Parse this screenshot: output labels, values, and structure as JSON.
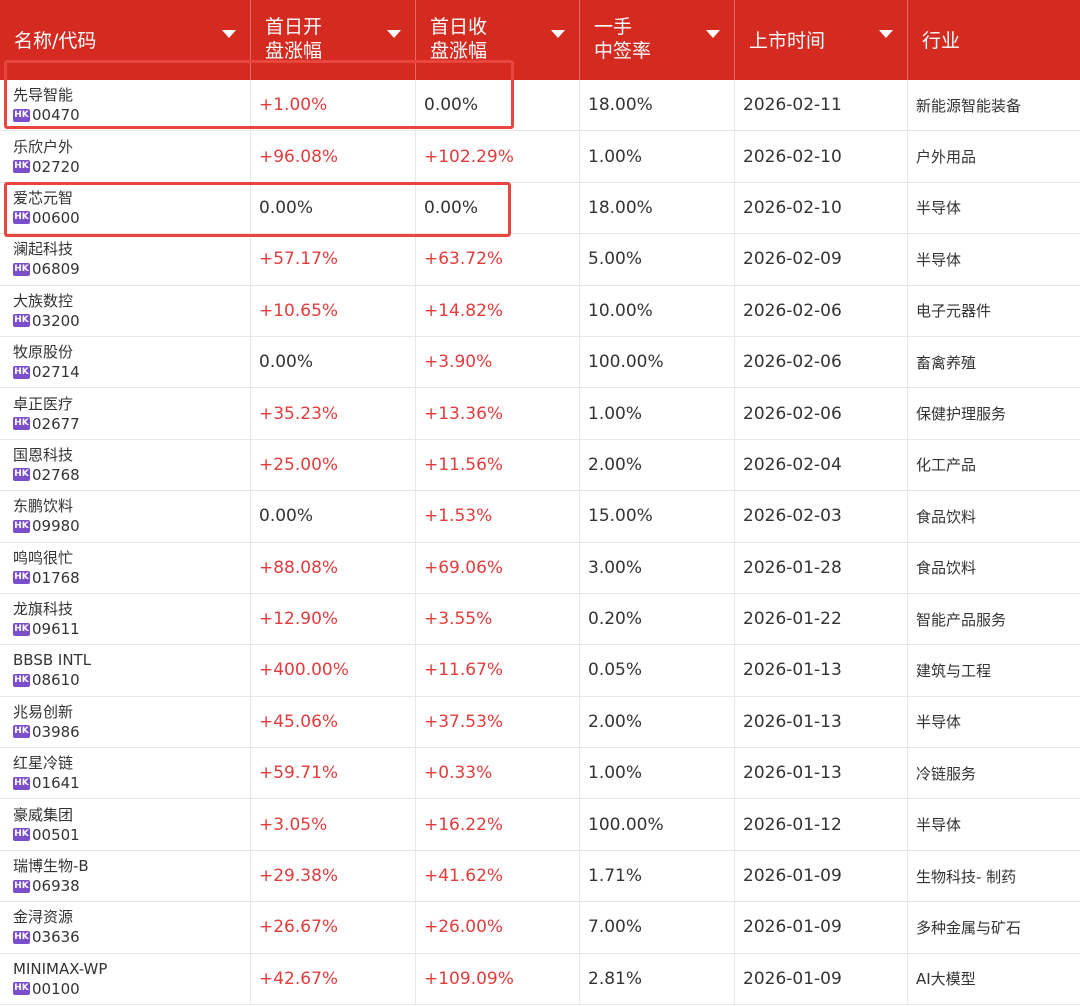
{
  "header": {
    "col_name": "名称/代码",
    "col_open_l1": "首日开",
    "col_open_l2": "盘涨幅",
    "col_close_l1": "首日收",
    "col_close_l2": "盘涨幅",
    "col_rate_l1": "一手",
    "col_rate_l2": "中签率",
    "col_date": "上市时间",
    "col_industry": "行业"
  },
  "badge": "HK",
  "colors": {
    "header_bg": "#d42a20",
    "positive": "#e23c3c",
    "badge": "#7b4fc9",
    "highlight": "#e8473f"
  },
  "rows": [
    {
      "name": "先导智能",
      "code": "00470",
      "open": "+1.00%",
      "close": "0.00%",
      "rate": "18.00%",
      "date": "2026-02-11",
      "industry": "新能源智能装备"
    },
    {
      "name": "乐欣户外",
      "code": "02720",
      "open": "+96.08%",
      "close": "+102.29%",
      "rate": "1.00%",
      "date": "2026-02-10",
      "industry": "户外用品"
    },
    {
      "name": "爱芯元智",
      "code": "00600",
      "open": "0.00%",
      "close": "0.00%",
      "rate": "18.00%",
      "date": "2026-02-10",
      "industry": "半导体"
    },
    {
      "name": "澜起科技",
      "code": "06809",
      "open": "+57.17%",
      "close": "+63.72%",
      "rate": "5.00%",
      "date": "2026-02-09",
      "industry": "半导体"
    },
    {
      "name": "大族数控",
      "code": "03200",
      "open": "+10.65%",
      "close": "+14.82%",
      "rate": "10.00%",
      "date": "2026-02-06",
      "industry": "电子元器件"
    },
    {
      "name": "牧原股份",
      "code": "02714",
      "open": "0.00%",
      "close": "+3.90%",
      "rate": "100.00%",
      "date": "2026-02-06",
      "industry": "畜禽养殖"
    },
    {
      "name": "卓正医疗",
      "code": "02677",
      "open": "+35.23%",
      "close": "+13.36%",
      "rate": "1.00%",
      "date": "2026-02-06",
      "industry": "保健护理服务"
    },
    {
      "name": "国恩科技",
      "code": "02768",
      "open": "+25.00%",
      "close": "+11.56%",
      "rate": "2.00%",
      "date": "2026-02-04",
      "industry": "化工产品"
    },
    {
      "name": "东鹏饮料",
      "code": "09980",
      "open": "0.00%",
      "close": "+1.53%",
      "rate": "15.00%",
      "date": "2026-02-03",
      "industry": "食品饮料"
    },
    {
      "name": "鸣鸣很忙",
      "code": "01768",
      "open": "+88.08%",
      "close": "+69.06%",
      "rate": "3.00%",
      "date": "2026-01-28",
      "industry": "食品饮料"
    },
    {
      "name": "龙旗科技",
      "code": "09611",
      "open": "+12.90%",
      "close": "+3.55%",
      "rate": "0.20%",
      "date": "2026-01-22",
      "industry": "智能产品服务"
    },
    {
      "name": "BBSB INTL",
      "code": "08610",
      "open": "+400.00%",
      "close": "+11.67%",
      "rate": "0.05%",
      "date": "2026-01-13",
      "industry": "建筑与工程"
    },
    {
      "name": "兆易创新",
      "code": "03986",
      "open": "+45.06%",
      "close": "+37.53%",
      "rate": "2.00%",
      "date": "2026-01-13",
      "industry": "半导体"
    },
    {
      "name": "红星冷链",
      "code": "01641",
      "open": "+59.71%",
      "close": "+0.33%",
      "rate": "1.00%",
      "date": "2026-01-13",
      "industry": "冷链服务"
    },
    {
      "name": "豪威集团",
      "code": "00501",
      "open": "+3.05%",
      "close": "+16.22%",
      "rate": "100.00%",
      "date": "2026-01-12",
      "industry": "半导体"
    },
    {
      "name": "瑞博生物-B",
      "code": "06938",
      "open": "+29.38%",
      "close": "+41.62%",
      "rate": "1.71%",
      "date": "2026-01-09",
      "industry": "生物科技- 制药"
    },
    {
      "name": "金浔资源",
      "code": "03636",
      "open": "+26.67%",
      "close": "+26.00%",
      "rate": "7.00%",
      "date": "2026-01-09",
      "industry": "多种金属与矿石"
    },
    {
      "name": "MINIMAX-WP",
      "code": "00100",
      "open": "+42.67%",
      "close": "+109.09%",
      "rate": "2.81%",
      "date": "2026-01-09",
      "industry": "AI大模型"
    }
  ]
}
